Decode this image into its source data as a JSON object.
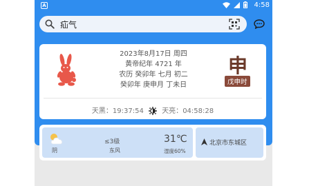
{
  "status_bar": {
    "app_badge": "A",
    "time": "4:58"
  },
  "search": {
    "query": "疝气"
  },
  "almanac": {
    "solar_date": "2023年8月17日 周四",
    "huangdi_year": "黄帝纪年 4721 年",
    "lunar_date": "农历 癸卯年 七月 初二",
    "ganzhi": "癸卯年 庚申月 丁未日",
    "hour_char": "申",
    "hour_name": "戊申时",
    "dark_label": "天黑：",
    "dark_time": "19:37:54",
    "light_label": "天亮：",
    "light_time": "04:58:28"
  },
  "weather": {
    "condition": "阴",
    "wind_level": "≤3级",
    "wind_dir": "东风",
    "temperature": "31℃",
    "humidity": "湿度60%"
  },
  "location": {
    "name": "北京市东城区"
  },
  "colors": {
    "primary": "#2f8def",
    "zodiac": "#e8584a",
    "hour_badge": "#8a4a3a"
  }
}
